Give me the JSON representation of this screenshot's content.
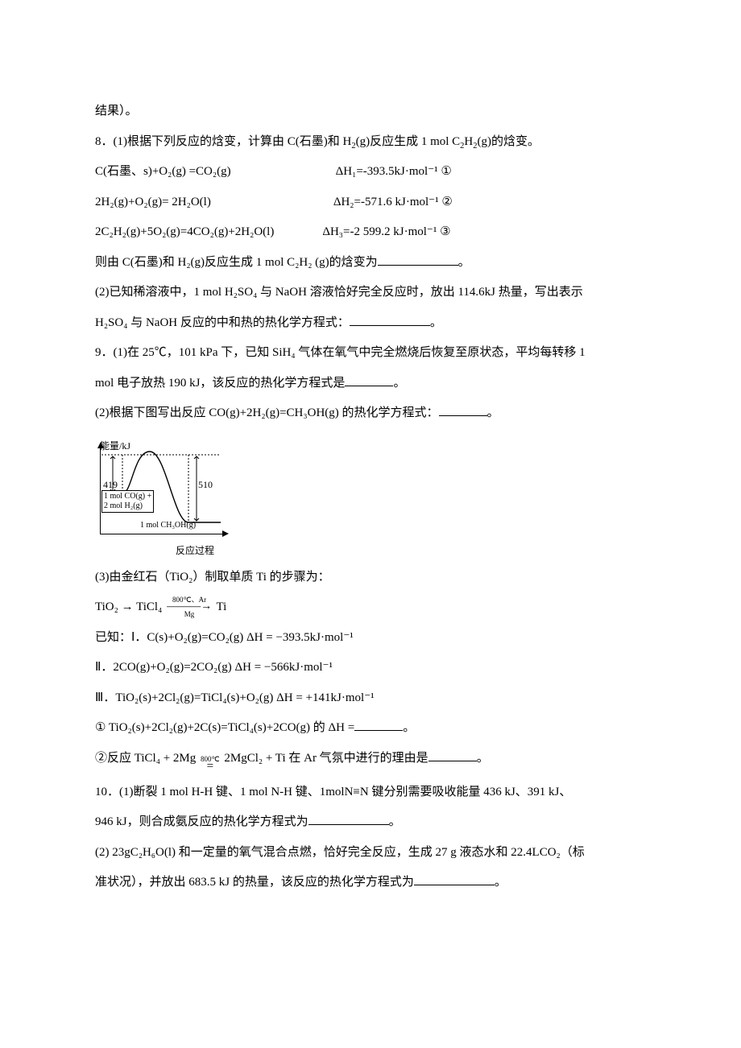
{
  "lines": {
    "l0": "结果）。",
    "l1a": "8．(1)根据下列反应的焓变，计算由 C(石墨)和 H",
    "l1b": "(g)反应生成 1 mol C",
    "l1c": "H",
    "l1d": "(g)的焓变。",
    "eq1_left": "C(石墨、s)+O₂(g) =CO₂(g)",
    "eq1_right": "ΔH₁=-393.5kJ·mol⁻¹ ①",
    "eq2_left": "2H₂(g)+O₂(g)= 2H₂O(l)",
    "eq2_right": "ΔH₂=-571.6 kJ·mol⁻¹ ②",
    "eq3_left": "2C₂H₂(g)+5O₂(g)=4CO₂(g)+2H₂O(l)",
    "eq3_right": "ΔH₃=-2 599.2 kJ·mol⁻¹ ③",
    "l5a": "则由 C(石墨)和 H₂(g)反应生成 1 mol C₂H₂ (g)的焓变为",
    "l5b": "。",
    "l6": "(2)已知稀溶液中，1 mol H₂SO₄ 与 NaOH 溶液恰好完全反应时，放出 114.6kJ 热量，写出表示",
    "l7a": "H₂SO₄ 与 NaOH 反应的中和热的热化学方程式：",
    "l7b": "。",
    "l8": "9．(1)在 25℃，101 kPa 下，已知 SiH₄ 气体在氧气中完全燃烧后恢复至原状态，平均每转移 1",
    "l9a": "mol 电子放热 190 kJ，该反应的热化学方程式是",
    "l9b": "。",
    "l10a": "(2)根据下图写出反应 CO(g)+2H₂(g)=CH₃OH(g) 的热化学方程式：",
    "l10b": "。",
    "l11": "(3)由金红石（TiO₂）制取单质 Ti 的步骤为：",
    "route_a": "TiO₂ → TiCl₄",
    "route_top": "800℃、Ar",
    "route_bot": "Mg",
    "route_b": "Ti",
    "l13": "已知：Ⅰ．C(s)+O₂(g)=CO₂(g) ΔH = −393.5kJ·mol⁻¹",
    "l14": "Ⅱ．2CO(g)+O₂(g)=2CO₂(g) ΔH = −566kJ·mol⁻¹",
    "l15": "Ⅲ．TiO₂(s)+2Cl₂(g)=TiCl₄(s)+O₂(g) ΔH = +141kJ·mol⁻¹",
    "l16a": "① TiO₂(s)+2Cl₂(g)+2C(s)=TiCl₄(s)+2CO(g) 的 ΔH =",
    "l16b": "。",
    "l17a": "②反应 TiCl₄ + 2Mg",
    "l17top": "800℃",
    "l17mid": "=",
    "l17b": " 2MgCl₂ + Ti 在 Ar 气氛中进行的理由是",
    "l17c": "。",
    "l18": "10．(1)断裂 1 mol H-H 键、1 mol N-H 键、1molN≡N 键分别需要吸收能量 436 kJ、391 kJ、",
    "l19a": "946 kJ，则合成氨反应的热化学方程式为",
    "l19b": "。",
    "l20": "(2) 23gC₂H₆O(l) 和一定量的氧气混合点燃，恰好完全反应，生成 27 g 液态水和 22.4LCO₂（标",
    "l21a": "准状况），并放出 683.5 kJ 的热量，该反应的热化学方程式为",
    "l21b": "。"
  },
  "chart_data": {
    "type": "line",
    "title": "",
    "xlabel": "反应过程",
    "ylabel": "能量/kJ",
    "annotations": {
      "left_rise": 419,
      "right_drop": 510,
      "start_label": "1 mol CO(g) + 2 mol H₂(g)",
      "end_label": "1 mol CH₃OH(g)"
    },
    "series": [
      {
        "name": "energy",
        "description": "Reactants plateau, activation barrier peak, products plateau (lower than reactants)"
      }
    ]
  }
}
